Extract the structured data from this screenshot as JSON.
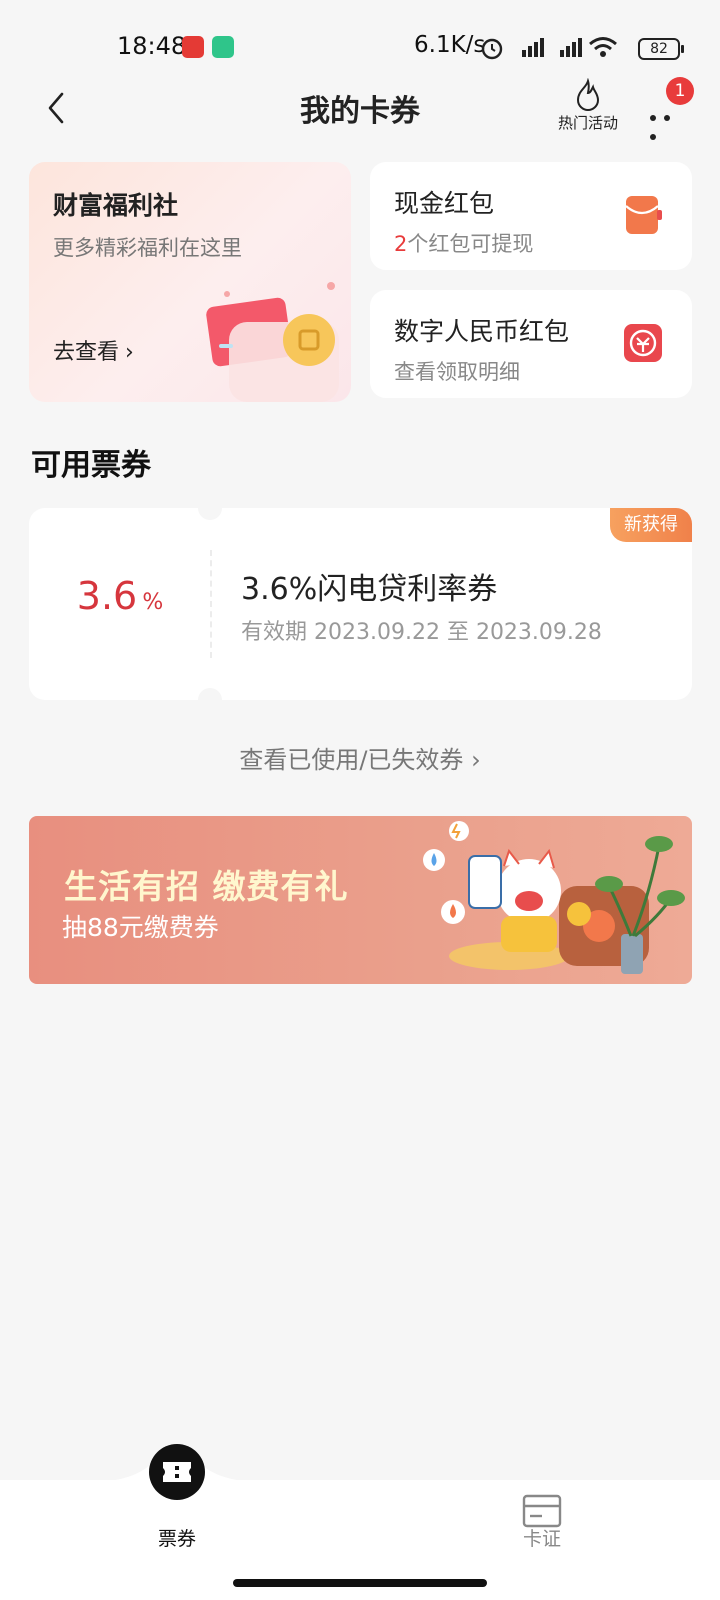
{
  "status_bar": {
    "time": "18:48",
    "network_speed": "6.1K/s",
    "battery": "82"
  },
  "header": {
    "title": "我的卡券",
    "hot_label": "热门活动",
    "notification_count": "1",
    "back_icon": "chevron-left-icon",
    "hot_icon": "flame-icon",
    "more_icon": "more-dots-icon"
  },
  "welfare_card": {
    "title": "财富福利社",
    "subtitle": "更多精彩福利在这里",
    "link": "去查看"
  },
  "cash_card": {
    "title": "现金红包",
    "count": "2",
    "subtitle_rest": "个红包可提现",
    "icon": "red-envelope-icon"
  },
  "digital_card": {
    "title": "数字人民币红包",
    "subtitle": "查看领取明细",
    "icon": "digital-rmb-icon"
  },
  "section": {
    "title": "可用票券"
  },
  "coupon": {
    "value": "3.6",
    "unit": "%",
    "name": "3.6%闪电贷利率券",
    "validity": "有效期 2023.09.22 至 2023.09.28",
    "tag": "新获得"
  },
  "view_used": "查看已使用/已失效券",
  "banner": {
    "title": "生活有招 缴费有礼",
    "subtitle": "抽88元缴费券"
  },
  "bottom_nav": [
    {
      "label": "票券",
      "icon": "ticket-icon",
      "active": true
    },
    {
      "label": "卡证",
      "icon": "card-icon",
      "active": false
    }
  ],
  "colors": {
    "accent_red": "#d6363d",
    "badge_red": "#e83b3b",
    "tag_orange": "#f0814a"
  }
}
